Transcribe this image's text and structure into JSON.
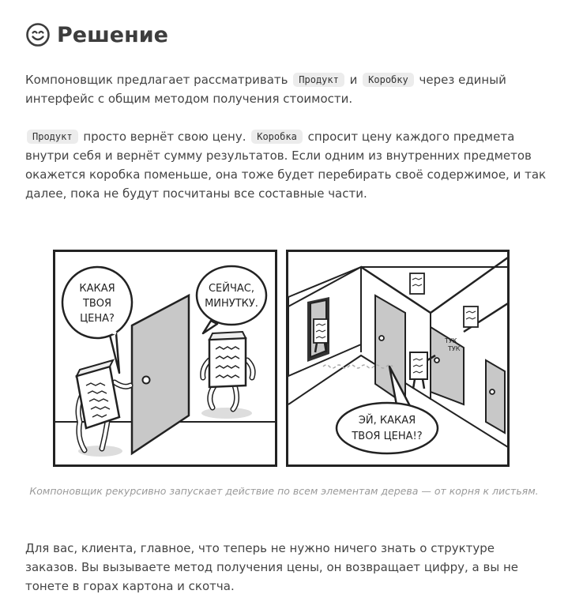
{
  "section": {
    "title": "Решение",
    "title_icon": "smiling-face-icon"
  },
  "paragraph1": {
    "before": "Компоновщик предлагает рассматривать ",
    "code1": "Продукт",
    "mid": " и ",
    "code2": "Коробку",
    "after": " через единый интерфейс с общим методом получения стоимости."
  },
  "paragraph2": {
    "code1": "Продукт",
    "text1": " просто вернёт свою цену. ",
    "code2": "Коробка",
    "text2": " спросит цену каждого предмета внутри себя и вернёт сумму результатов. Если одним из внутренних предметов окажется коробка поменьше, она тоже будет перебирать своё содержимое, и так далее, пока не будут посчитаны все составные части."
  },
  "illustration": {
    "panel1_bubble_left": [
      "КАКАЯ",
      "ТВОЯ",
      "ЦЕНА?"
    ],
    "panel1_bubble_right": [
      "СЕЙЧАС,",
      "МИНУТКУ."
    ],
    "panel2_knock": [
      "ТУК",
      "ТУК"
    ],
    "panel2_bubble": [
      "ЭЙ, КАКАЯ",
      "ТВОЯ ЦЕНА!?"
    ]
  },
  "caption": "Компоновщик рекурсивно запускает действие по всем элементам дерева — от корня к листьям.",
  "paragraph3": "Для вас, клиента, главное, что теперь не нужно ничего знать о структуре заказов. Вы вызываете метод получения цены, он возвращает цифру, а вы не тонете в горах картона и скотча."
}
